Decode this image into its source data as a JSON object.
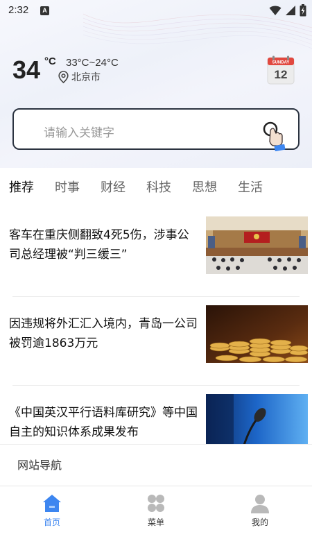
{
  "status_bar": {
    "time": "2:32",
    "notification_glyph": "A",
    "icons": [
      "wifi-icon",
      "signal-icon",
      "battery-icon"
    ]
  },
  "weather": {
    "temperature": "34",
    "unit": "°C",
    "range": "33°C~24°C",
    "location": "北京市"
  },
  "calendar": {
    "weekday": "SUNDAY",
    "day": "12"
  },
  "search": {
    "placeholder": "请输入关键字"
  },
  "tabs": [
    {
      "label": "推荐",
      "active": true
    },
    {
      "label": "时事",
      "active": false
    },
    {
      "label": "财经",
      "active": false
    },
    {
      "label": "科技",
      "active": false
    },
    {
      "label": "思想",
      "active": false
    },
    {
      "label": "生活",
      "active": false
    }
  ],
  "news": [
    {
      "title": "客车在重庆侧翻致4死5伤，涉事公司总经理被“判三缓三”",
      "image": "courtroom"
    },
    {
      "title": "因违规将外汇汇入境内，青岛一公司被罚逾1863万元",
      "image": "gold-coins"
    },
    {
      "title": "《中国英汉平行语料库研究》等中国自主的知识体系成果发布",
      "image": "microphone"
    }
  ],
  "site_nav": {
    "label": "网站导航"
  },
  "bottom_nav": [
    {
      "label": "首页",
      "icon": "home-icon",
      "active": true
    },
    {
      "label": "菜单",
      "icon": "menu-grid-icon",
      "active": false
    },
    {
      "label": "我的",
      "icon": "user-icon",
      "active": false
    }
  ],
  "colors": {
    "accent": "#3d86f0",
    "search_border": "#2b3340"
  }
}
